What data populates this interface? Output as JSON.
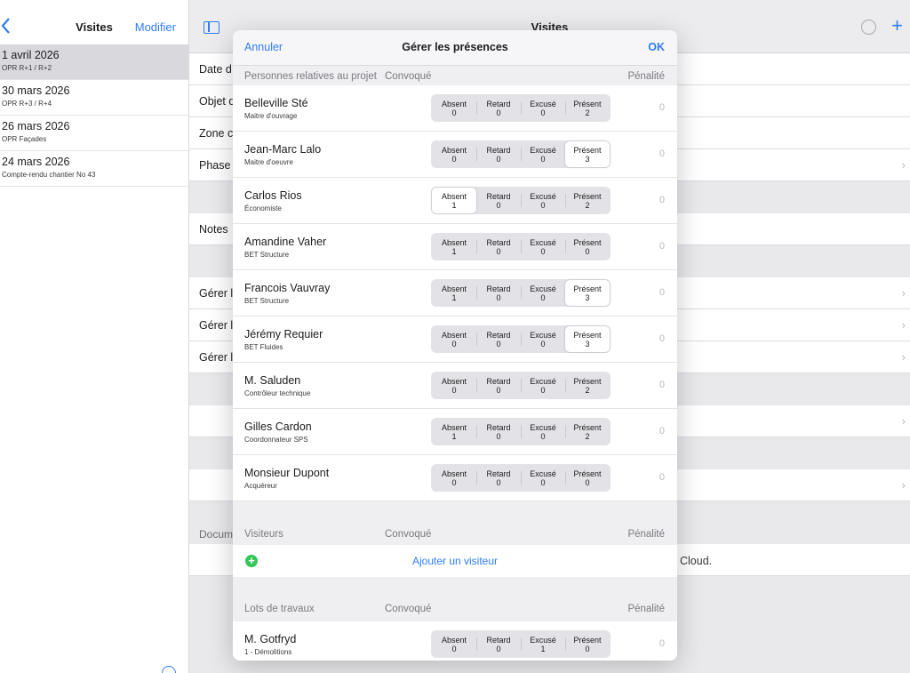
{
  "sidebar": {
    "title": "Visites",
    "edit_label": "Modifier",
    "visits": [
      {
        "date": "1 avril 2026",
        "subtitle": "OPR R+1 / R+2"
      },
      {
        "date": "30 mars 2026",
        "subtitle": "OPR R+3 / R+4"
      },
      {
        "date": "26 mars 2026",
        "subtitle": "OPR Façades"
      },
      {
        "date": "24 mars 2026",
        "subtitle": "Compte-rendu chantier No 43"
      }
    ]
  },
  "detail": {
    "title": "Visites",
    "rows": [
      "Date d",
      "Objet d",
      "Zone c",
      "Phase",
      "Notes",
      "Gérer l",
      "Gérer l",
      "Gérer l"
    ],
    "documents_label": "Docum",
    "footer_text": "Cloud."
  },
  "modal": {
    "cancel_label": "Annuler",
    "title": "Gérer les présences",
    "ok_label": "OK",
    "segment_labels": [
      "Absent",
      "Retard",
      "Excusé",
      "Présent"
    ],
    "section_persons": {
      "label": "Personnes relatives au projet",
      "convoque": "Convoqué",
      "penalite": "Pénalité"
    },
    "persons": [
      {
        "name": "Belleville Sté",
        "role": "Maitre d'ouvrage",
        "counts": [
          "0",
          "0",
          "0",
          "2"
        ],
        "penalty": "0"
      },
      {
        "name": "Jean-Marc Lalo",
        "role": "Maitre d'oeuvre",
        "counts": [
          "0",
          "0",
          "0",
          "3"
        ],
        "penalty": "0"
      },
      {
        "name": "Carlos Rios",
        "role": "Économiste",
        "counts": [
          "1",
          "0",
          "0",
          "2"
        ],
        "penalty": "0"
      },
      {
        "name": "Amandine Vaher",
        "role": "BET Structure",
        "counts": [
          "1",
          "0",
          "0",
          "0"
        ],
        "penalty": "0"
      },
      {
        "name": "Francois Vauvray",
        "role": "BET Structure",
        "counts": [
          "1",
          "0",
          "0",
          "3"
        ],
        "penalty": "0"
      },
      {
        "name": "Jérémy Requier",
        "role": "BET Fluides",
        "counts": [
          "0",
          "0",
          "0",
          "3"
        ],
        "penalty": "0"
      },
      {
        "name": "M. Saluden",
        "role": "Contrôleur technique",
        "counts": [
          "0",
          "0",
          "0",
          "2"
        ],
        "penalty": "0"
      },
      {
        "name": "Gilles Cardon",
        "role": "Coordonnateur SPS",
        "counts": [
          "1",
          "0",
          "0",
          "2"
        ],
        "penalty": "0"
      },
      {
        "name": "Monsieur Dupont",
        "role": "Acquéreur",
        "counts": [
          "0",
          "0",
          "0",
          "0"
        ],
        "penalty": "0"
      }
    ],
    "section_visitors": {
      "label": "Visiteurs",
      "convoque": "Convoqué",
      "penalite": "Pénalité"
    },
    "add_visitor_label": "Ajouter un visiteur",
    "section_lots": {
      "label": "Lots de travaux",
      "convoque": "Convoqué",
      "penalite": "Pénalité"
    },
    "lots": [
      {
        "name": "M. Gotfryd",
        "role": "1 - Démolitions",
        "counts": [
          "0",
          "0",
          "1",
          "0"
        ],
        "penalty": "0"
      }
    ]
  },
  "colors": {
    "accent": "#2f7cf6",
    "add_green": "#35c759"
  }
}
